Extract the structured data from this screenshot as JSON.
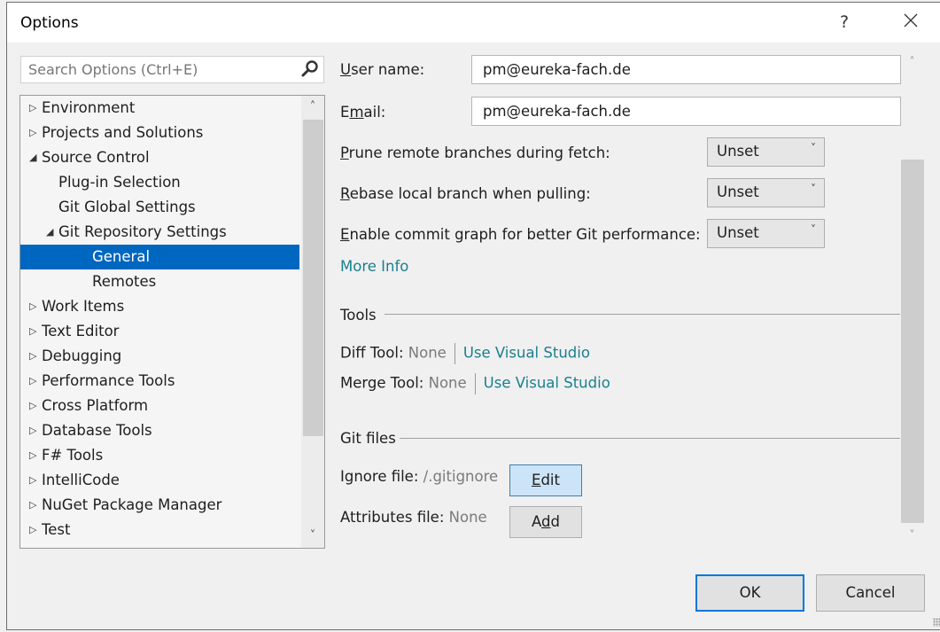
{
  "window": {
    "title": "Options",
    "help_label": "?",
    "close_icon": "close-icon"
  },
  "search": {
    "placeholder": "Search Options (Ctrl+E)",
    "value": "",
    "icon": "search-icon"
  },
  "tree": {
    "items": [
      {
        "label": "Environment",
        "level": 0,
        "state": "collapsed"
      },
      {
        "label": "Projects and Solutions",
        "level": 0,
        "state": "collapsed"
      },
      {
        "label": "Source Control",
        "level": 0,
        "state": "expanded"
      },
      {
        "label": "Plug-in Selection",
        "level": 1,
        "state": "leaf"
      },
      {
        "label": "Git Global Settings",
        "level": 1,
        "state": "leaf"
      },
      {
        "label": "Git Repository Settings",
        "level": 1,
        "state": "expanded"
      },
      {
        "label": "General",
        "level": 2,
        "state": "leaf",
        "selected": true
      },
      {
        "label": "Remotes",
        "level": 2,
        "state": "leaf"
      },
      {
        "label": "Work Items",
        "level": 0,
        "state": "collapsed"
      },
      {
        "label": "Text Editor",
        "level": 0,
        "state": "collapsed"
      },
      {
        "label": "Debugging",
        "level": 0,
        "state": "collapsed"
      },
      {
        "label": "Performance Tools",
        "level": 0,
        "state": "collapsed"
      },
      {
        "label": "Cross Platform",
        "level": 0,
        "state": "collapsed"
      },
      {
        "label": "Database Tools",
        "level": 0,
        "state": "collapsed"
      },
      {
        "label": "F# Tools",
        "level": 0,
        "state": "collapsed"
      },
      {
        "label": "IntelliCode",
        "level": 0,
        "state": "collapsed"
      },
      {
        "label": "NuGet Package Manager",
        "level": 0,
        "state": "collapsed"
      },
      {
        "label": "Test",
        "level": 0,
        "state": "collapsed"
      }
    ]
  },
  "settings": {
    "user_name": {
      "label_first": "U",
      "label_rest": "ser name:",
      "value": "pm@eureka-fach.de"
    },
    "email": {
      "label_first": "E",
      "label_mid": "m",
      "label_rest": "ail:",
      "value": "pm@eureka-fach.de"
    },
    "prune": {
      "label_first": "P",
      "label_rest": "rune remote branches during fetch:",
      "value": "Unset"
    },
    "rebase": {
      "label_first": "R",
      "label_rest": "ebase local branch when pulling:",
      "value": "Unset"
    },
    "commit_graph": {
      "label_first": "E",
      "label_rest": "nable commit graph for better Git performance:",
      "value": "Unset"
    },
    "more_info": "More Info"
  },
  "tools": {
    "heading": "Tools",
    "diff": {
      "label": "Diff Tool:",
      "value": "None",
      "action": "Use Visual Studio"
    },
    "merge": {
      "label": "Merge Tool:",
      "value": "None",
      "action": "Use Visual Studio"
    }
  },
  "git_files": {
    "heading": "Git files",
    "ignore": {
      "label": "Ignore file:",
      "value": "/.gitignore",
      "button_first": "E",
      "button_rest": "dit"
    },
    "attributes": {
      "label": "Attributes file:",
      "value": "None",
      "button_a": "A",
      "button_d": "d",
      "button_rest": "d"
    }
  },
  "footer": {
    "ok": "OK",
    "cancel": "Cancel"
  }
}
